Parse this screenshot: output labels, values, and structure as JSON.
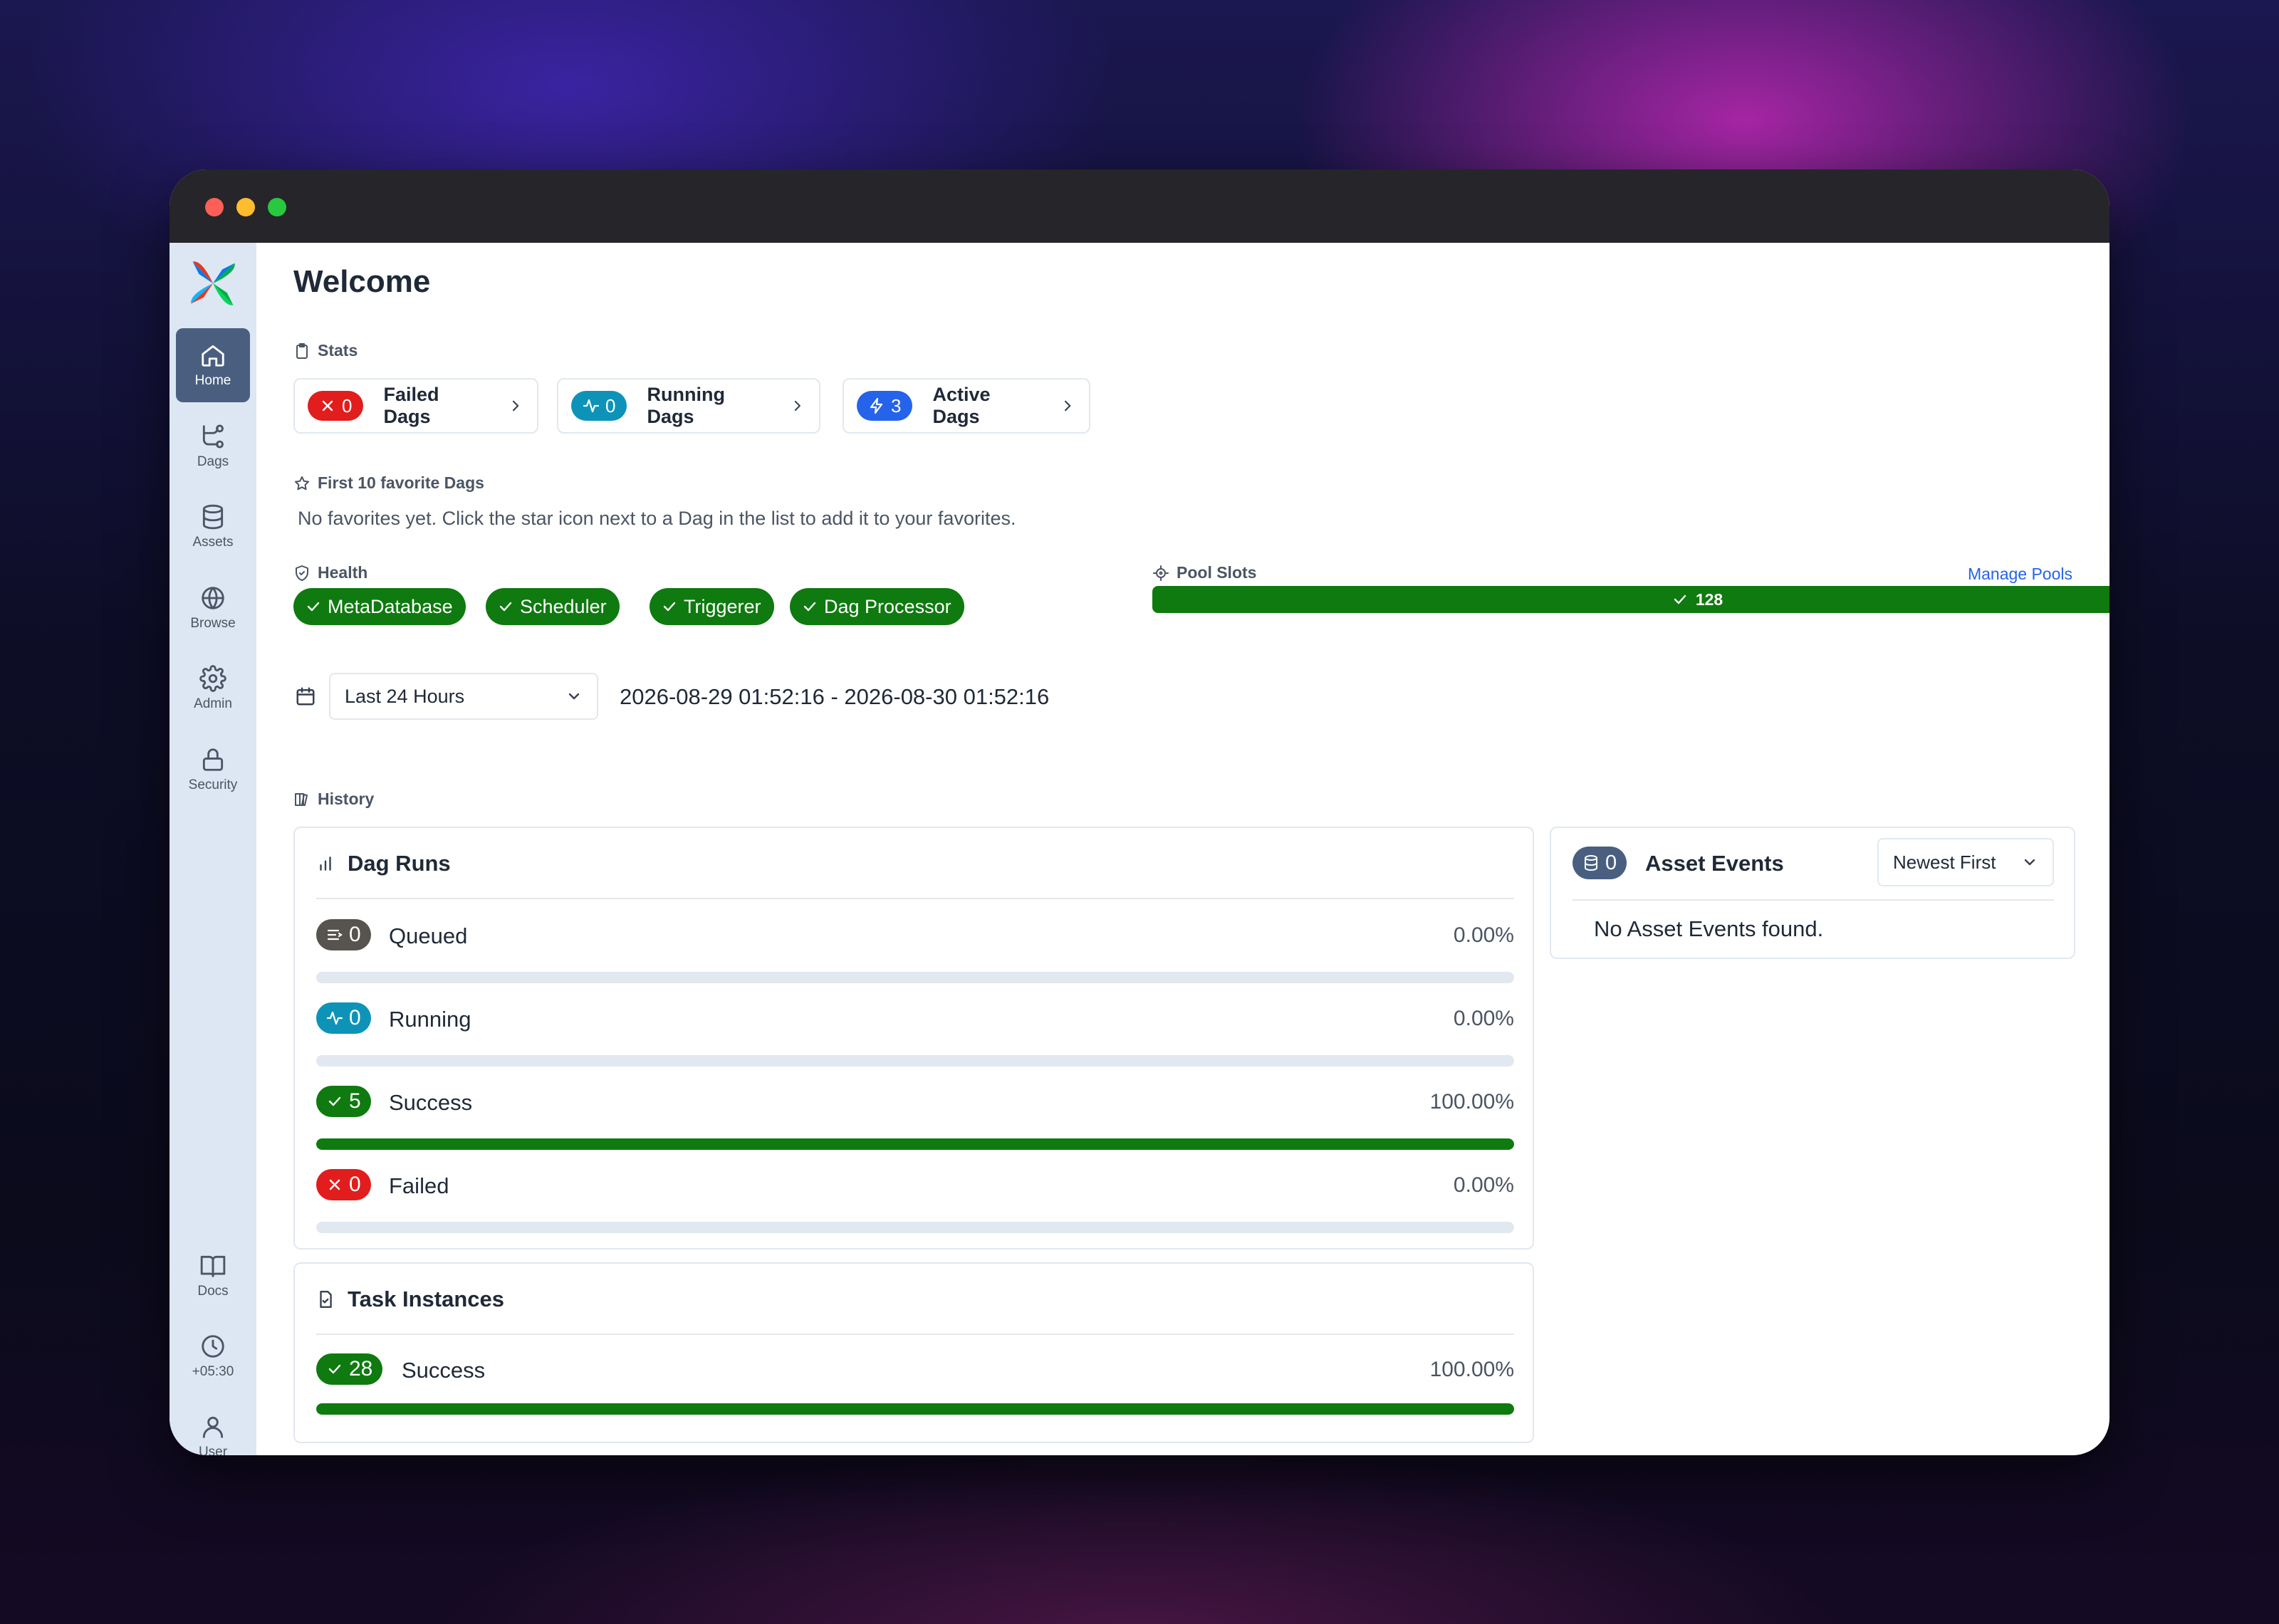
{
  "nav": {
    "items": [
      {
        "label": "Home",
        "icon": "home-icon"
      },
      {
        "label": "Dags",
        "icon": "dags-icon"
      },
      {
        "label": "Assets",
        "icon": "database-icon"
      },
      {
        "label": "Browse",
        "icon": "globe-icon"
      },
      {
        "label": "Admin",
        "icon": "gear-icon"
      },
      {
        "label": "Security",
        "icon": "lock-icon"
      }
    ],
    "bottom": [
      {
        "label": "Docs",
        "icon": "book-icon"
      },
      {
        "label": "+05:30",
        "icon": "clock-icon"
      },
      {
        "label": "User",
        "icon": "user-icon"
      }
    ]
  },
  "page": {
    "title": "Welcome"
  },
  "stats": {
    "label": "Stats",
    "cards": [
      {
        "count": "0",
        "label": "Failed Dags",
        "color": "#e11d1d"
      },
      {
        "count": "0",
        "label": "Running Dags",
        "color": "#0e93b8"
      },
      {
        "count": "3",
        "label": "Active Dags",
        "color": "#2563eb"
      }
    ]
  },
  "favorites": {
    "label": "First 10 favorite Dags",
    "empty_text": "No favorites yet. Click the star icon next to a Dag in the list to add it to your favorites."
  },
  "health": {
    "label": "Health",
    "items": [
      "MetaDatabase",
      "Scheduler",
      "Triggerer",
      "Dag Processor"
    ],
    "color": "#0f7a0f"
  },
  "pool": {
    "label": "Pool Slots",
    "manage_link": "Manage Pools",
    "slots": "128"
  },
  "time_range": {
    "selected": "Last 24 Hours",
    "range_text": "2026-08-29 01:52:16 - 2026-08-30 01:52:16"
  },
  "history": {
    "label": "History",
    "dag_runs": {
      "title": "Dag Runs",
      "rows": [
        {
          "state": "Queued",
          "count": "0",
          "pct": "0.00%",
          "fill": 0,
          "color": "#57534e"
        },
        {
          "state": "Running",
          "count": "0",
          "pct": "0.00%",
          "fill": 0,
          "color": "#0e93b8"
        },
        {
          "state": "Success",
          "count": "5",
          "pct": "100.00%",
          "fill": 1,
          "color": "#0f7a0f"
        },
        {
          "state": "Failed",
          "count": "0",
          "pct": "0.00%",
          "fill": 0,
          "color": "#e11d1d"
        }
      ]
    },
    "task_instances": {
      "title": "Task Instances",
      "rows": [
        {
          "state": "Success",
          "count": "28",
          "pct": "100.00%",
          "fill": 1,
          "color": "#0f7a0f"
        }
      ]
    }
  },
  "asset_events": {
    "title": "Asset Events",
    "count": "0",
    "sort": "Newest First",
    "empty_text": "No Asset Events found.",
    "badge_color": "#4a5f80"
  }
}
